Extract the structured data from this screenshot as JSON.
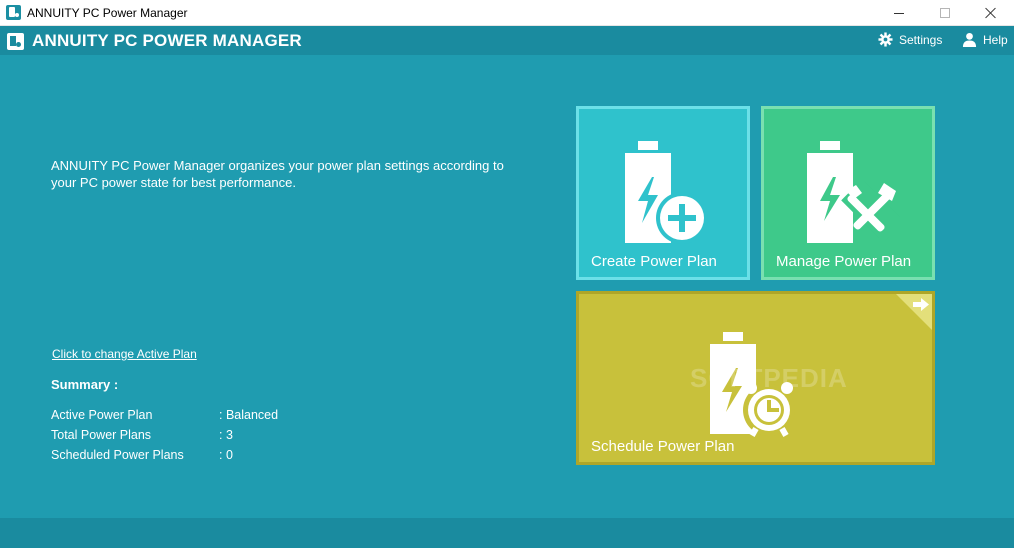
{
  "window": {
    "title": "ANNUITY PC Power Manager"
  },
  "header": {
    "title": "ANNUITY PC POWER MANAGER",
    "settings_label": "Settings",
    "help_label": "Help"
  },
  "main": {
    "description": "ANNUITY PC Power Manager organizes your power plan settings according to your PC power state for best performance.",
    "change_plan_link": "Click to change Active Plan",
    "summary": {
      "title": "Summary :",
      "rows": [
        {
          "label": "Active Power Plan",
          "value": ": Balanced"
        },
        {
          "label": "Total Power Plans",
          "value": ": 3"
        },
        {
          "label": "Scheduled Power Plans",
          "value": ": 0"
        }
      ]
    }
  },
  "tiles": {
    "create": {
      "label": "Create Power Plan",
      "icon": "battery-plus-icon"
    },
    "manage": {
      "label": "Manage Power Plan",
      "icon": "battery-tools-icon"
    },
    "schedule": {
      "label": "Schedule Power Plan",
      "icon": "battery-clock-icon"
    }
  },
  "watermark": "SOFTPEDIA",
  "colors": {
    "header": "#1a8b9f",
    "main_bg": "#1f9cb0",
    "create_tile": "#2fc2cc",
    "manage_tile": "#3ec98a",
    "schedule_tile": "#c8c13b"
  }
}
